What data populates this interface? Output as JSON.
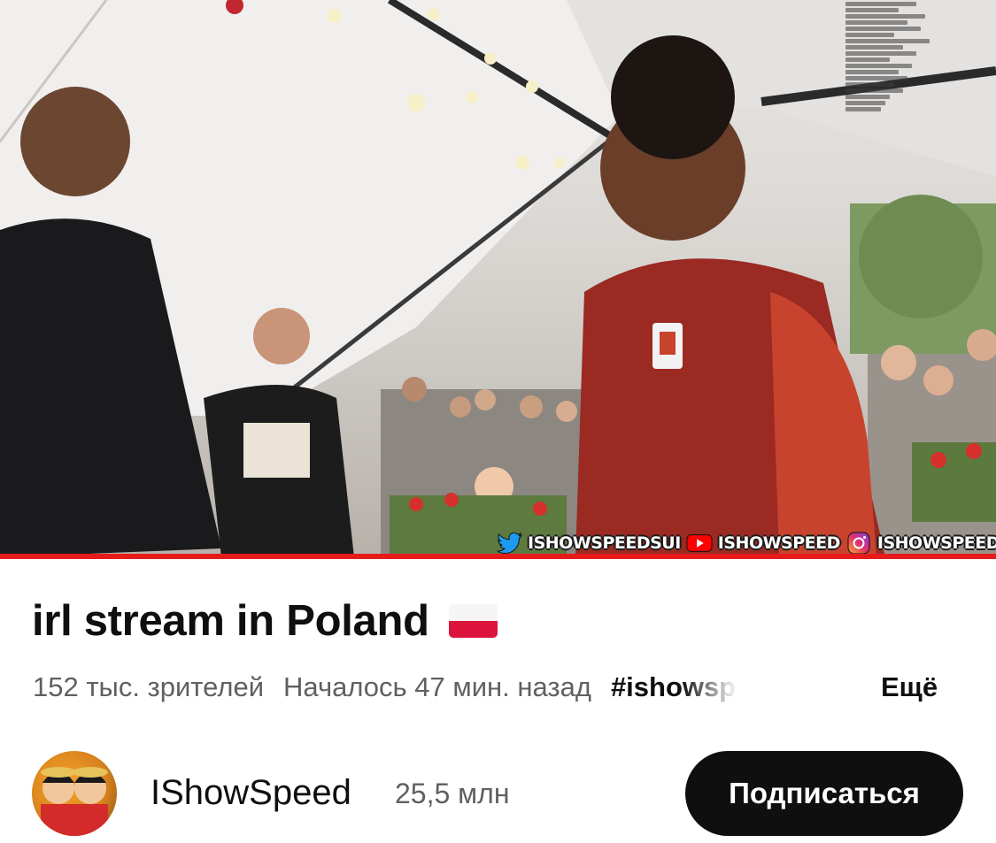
{
  "video": {
    "overlay_socials": [
      {
        "icon": "twitter-icon",
        "handle": "ISHOWSPEEDSUI"
      },
      {
        "icon": "youtube-icon",
        "handle": "ISHOWSPEED"
      },
      {
        "icon": "instagram-icon",
        "handle": "ISHOWSPEED"
      }
    ],
    "progress_color": "#e81b1b"
  },
  "stream": {
    "title": "irl stream in Poland",
    "flag": "poland-flag-emoji",
    "viewers": "152 тыс. зрителей",
    "started": "Началось 47 мин. назад",
    "hashtag": "#ishowspeed",
    "more_label": "Ещё"
  },
  "channel": {
    "name": "IShowSpeed",
    "subscribers": "25,5 млн",
    "subscribe_label": "Подписаться",
    "avatar": "channel-avatar"
  },
  "colors": {
    "primary_text": "#0f0f0f",
    "secondary_text": "#606060",
    "subscribe_bg": "#0f0f0f",
    "live_bar": "#e81b1b"
  }
}
